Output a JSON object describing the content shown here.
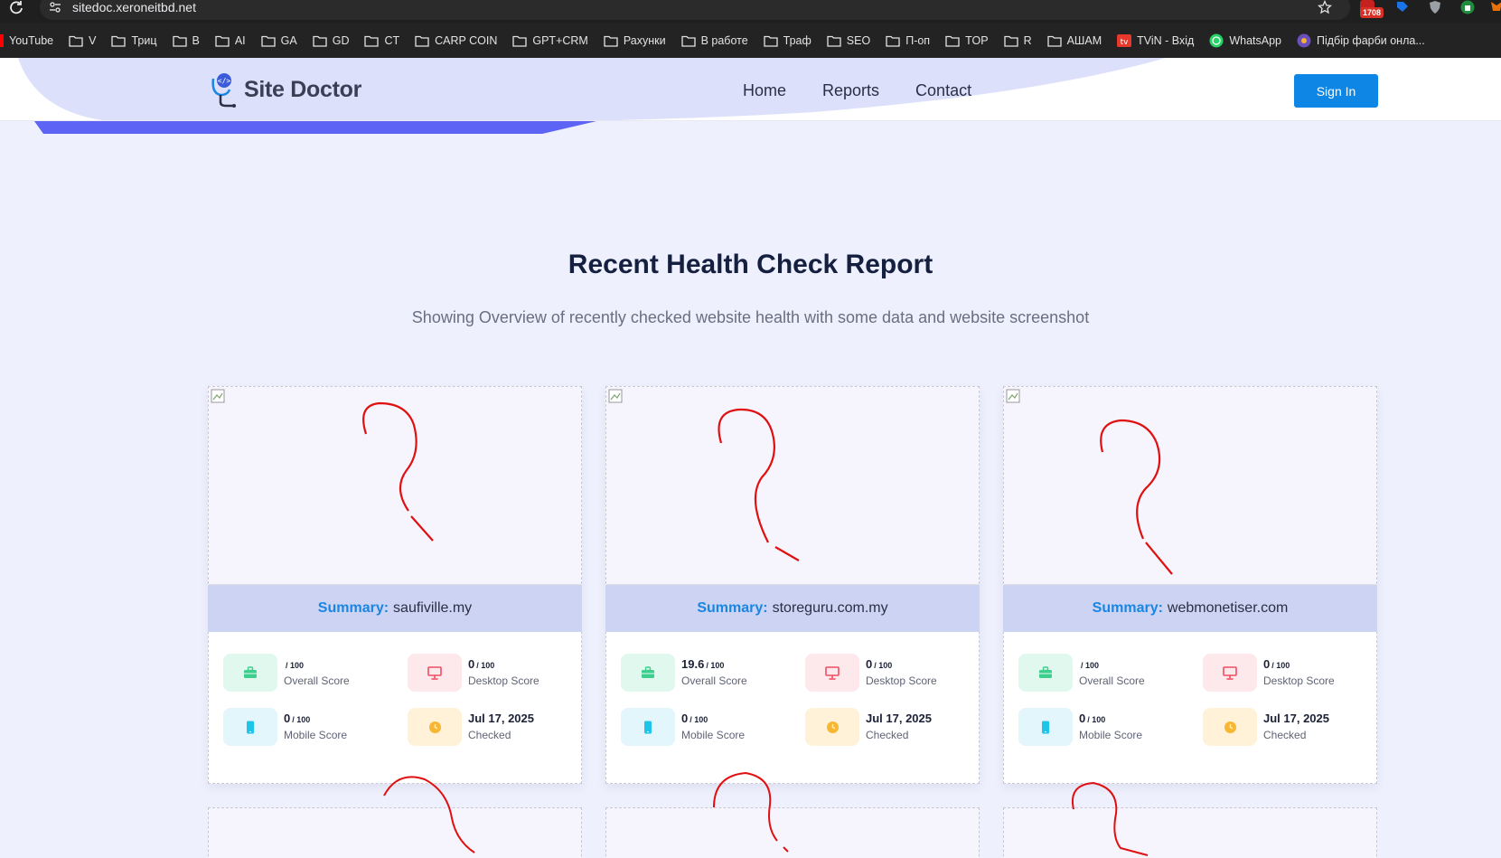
{
  "browser": {
    "url": "sitedoc.xeroneitbd.net",
    "extension_badge": "1708",
    "bookmarks": [
      "YouTube",
      "V",
      "Триц",
      "B",
      "AI",
      "GA",
      "GD",
      "CT",
      "CARP COIN",
      "GPT+CRM",
      "Рахунки",
      "В работе",
      "Траф",
      "SEO",
      "П-оп",
      "TOP",
      "R",
      "АШАМ",
      "TViN - Вхід",
      "WhatsApp",
      "Підбір фарби онла..."
    ]
  },
  "header": {
    "logo_text": "Site Doctor",
    "nav": [
      "Home",
      "Reports",
      "Contact"
    ],
    "active_nav": "Home",
    "sign_in": "Sign In"
  },
  "section": {
    "title": "Recent Health Check Report",
    "subtitle": "Showing Overview of recently checked website health with some data and website screenshot"
  },
  "cards": [
    {
      "summary_label": "Summary:",
      "domain": "saufiville.my",
      "overall_score": "",
      "overall_label": "Overall Score",
      "desktop_score": "0",
      "desktop_label": "Desktop Score",
      "mobile_score": "0",
      "mobile_label": "Mobile Score",
      "checked_date": "Jul 17, 2025",
      "checked_label": "Checked",
      "unit": "/ 100"
    },
    {
      "summary_label": "Summary:",
      "domain": "storeguru.com.my",
      "overall_score": "19.6",
      "overall_label": "Overall Score",
      "desktop_score": "0",
      "desktop_label": "Desktop Score",
      "mobile_score": "0",
      "mobile_label": "Mobile Score",
      "checked_date": "Jul 17, 2025",
      "checked_label": "Checked",
      "unit": "/ 100"
    },
    {
      "summary_label": "Summary:",
      "domain": "webmonetiser.com",
      "overall_score": "",
      "overall_label": "Overall Score",
      "desktop_score": "0",
      "desktop_label": "Desktop Score",
      "mobile_score": "0",
      "mobile_label": "Mobile Score",
      "checked_date": "Jul 17, 2025",
      "checked_label": "Checked",
      "unit": "/ 100"
    }
  ],
  "colors": {
    "primary": "#0d86e6",
    "summary_bg": "#ccd3f3",
    "annotation": "#e01010",
    "green": "#3ecf8e",
    "red": "#ef4d63",
    "cyan": "#1ec5e8",
    "amber": "#f7b733"
  }
}
